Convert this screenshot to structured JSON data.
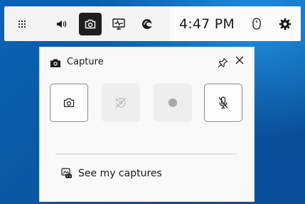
{
  "toolbar": {
    "time": "4:47 PM",
    "buttons": [
      {
        "name": "widget-menu-icon"
      },
      {
        "name": "audio-icon"
      },
      {
        "name": "capture-icon",
        "active": true
      },
      {
        "name": "performance-icon"
      },
      {
        "name": "edge-icon"
      }
    ]
  },
  "capture_panel": {
    "title": "Capture",
    "see_captures_label": "See my captures"
  },
  "colors": {
    "active_button": "#1f1f1f",
    "desktop_blue": "#0a57a3"
  }
}
